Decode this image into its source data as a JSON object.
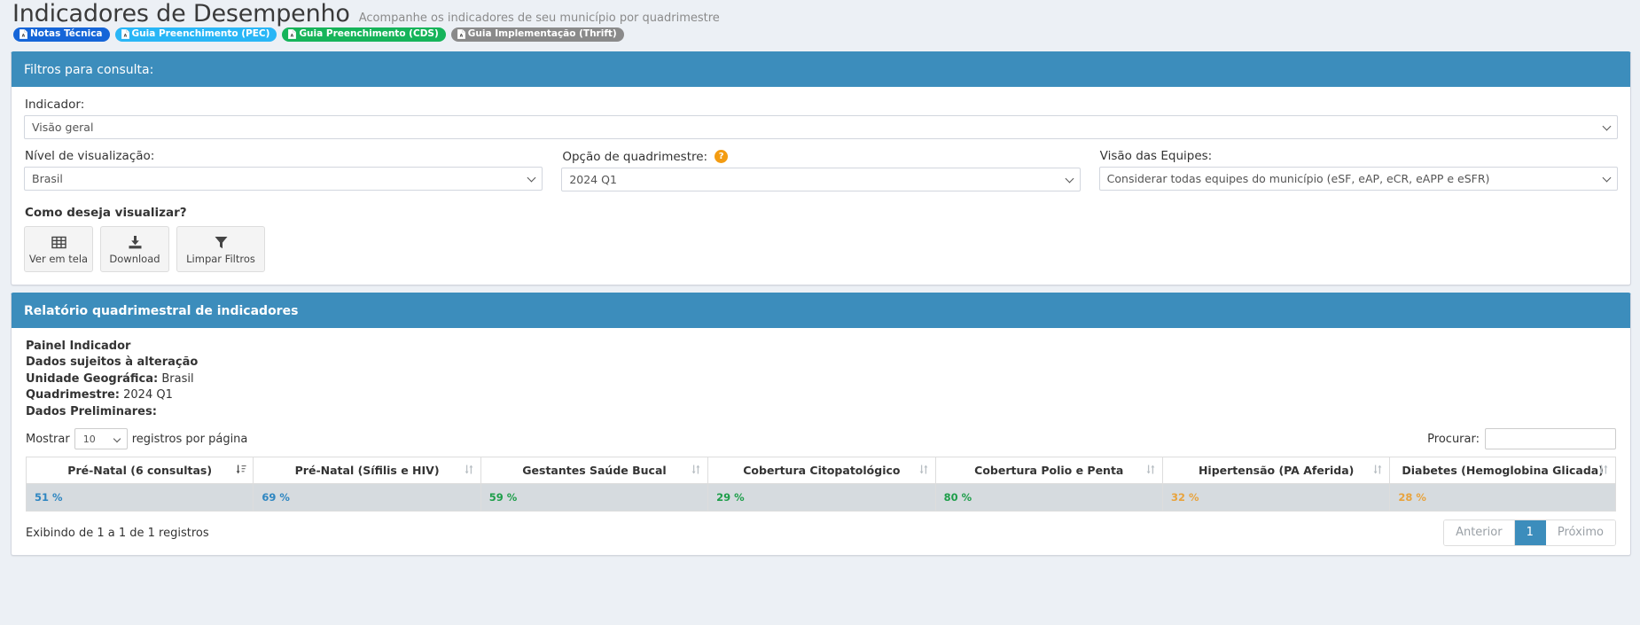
{
  "header": {
    "title": "Indicadores de Desempenho",
    "subtitle": "Acompanhe os indicadores de seu município por quadrimestre",
    "badges": [
      {
        "label": "Notas Técnica",
        "color": "#1565d8",
        "icon": "pdf-file-icon"
      },
      {
        "label": "Guia Preenchimento (PEC)",
        "color": "#29b6f6",
        "icon": "pdf-file-icon"
      },
      {
        "label": "Guia Preenchimento (CDS)",
        "color": "#16b45a",
        "icon": "pdf-file-icon"
      },
      {
        "label": "Guia Implementação (Thrift)",
        "color": "#8a8a8a",
        "icon": "pdf-file-icon"
      }
    ]
  },
  "filters_panel": {
    "heading": "Filtros para consulta:",
    "indicator": {
      "label": "Indicador:",
      "value": "Visão geral"
    },
    "level": {
      "label": "Nível de visualização:",
      "value": "Brasil"
    },
    "quadrimestre": {
      "label": "Opção de quadrimestre:",
      "help_icon": "question-mark-icon",
      "value": "2024 Q1"
    },
    "teams": {
      "label": "Visão das Equipes:",
      "value": "Considerar todas equipes do município (eSF, eAP, eCR, eAPP e eSFR)"
    },
    "how_title": "Como deseja visualizar?",
    "actions": [
      {
        "label": "Ver em tela",
        "icon": "table-grid-icon"
      },
      {
        "label": "Download",
        "icon": "download-icon"
      },
      {
        "label": "Limpar Filtros",
        "icon": "funnel-filter-icon"
      }
    ]
  },
  "report_panel": {
    "heading": "Relatório quadrimestral de indicadores",
    "meta": [
      {
        "label": "Painel Indicador",
        "value": ""
      },
      {
        "label": "Dados sujeitos à alteração",
        "value": ""
      },
      {
        "label": "Unidade Geográfica:",
        "value": " Brasil"
      },
      {
        "label": "Quadrimestre:",
        "value": " 2024 Q1"
      },
      {
        "label": "Dados Preliminares:",
        "value": ""
      }
    ],
    "length_label_before": "Mostrar",
    "length_value": "10",
    "length_label_after": "registros por página",
    "search_label": "Procurar:",
    "search_value": "",
    "search_placeholder": "",
    "table": {
      "columns": [
        {
          "header": "Pré-Natal (6 consultas)",
          "sort": "sorted-asc-icon"
        },
        {
          "header": "Pré-Natal (Sífilis e HIV)",
          "sort": "sortable-icon"
        },
        {
          "header": "Gestantes Saúde Bucal",
          "sort": "sortable-icon"
        },
        {
          "header": "Cobertura Citopatológico",
          "sort": "sortable-icon"
        },
        {
          "header": "Cobertura Polio e Penta",
          "sort": "sortable-icon"
        },
        {
          "header": "Hipertensão (PA Aferida)",
          "sort": "sortable-icon"
        },
        {
          "header": "Diabetes (Hemoglobina Glicada)",
          "sort": "sortable-icon"
        }
      ],
      "rows": [
        [
          {
            "value": "51 %",
            "color": "#2e86c1"
          },
          {
            "value": "69 %",
            "color": "#2e86c1"
          },
          {
            "value": "59 %",
            "color": "#1e9e4a"
          },
          {
            "value": "29 %",
            "color": "#1e9e4a"
          },
          {
            "value": "80 %",
            "color": "#1e9e4a"
          },
          {
            "value": "32 %",
            "color": "#e8a33d"
          },
          {
            "value": "28 %",
            "color": "#e8a33d"
          }
        ]
      ]
    },
    "info_text": "Exibindo de 1 a 1 de 1 registros",
    "pagination": {
      "previous": "Anterior",
      "pages": [
        "1"
      ],
      "next": "Próximo",
      "active_page": "1"
    }
  },
  "theme": {
    "panel_blue": "#3c8dbc",
    "page_bg": "#ecf0f5",
    "help_orange": "#f39c12"
  }
}
